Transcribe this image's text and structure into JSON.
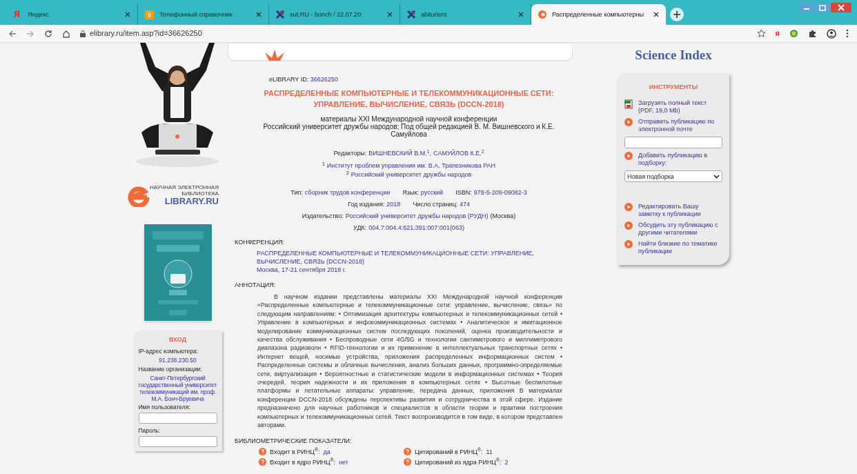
{
  "browser": {
    "tabs": [
      {
        "kind": "letter",
        "glyph": "Я",
        "title": "Яндекс",
        "selected": false
      },
      {
        "kind": "square",
        "glyph": "))",
        "title": "Телефонный справочник",
        "selected": false
      },
      {
        "kind": "cross",
        "title": "sut.RU - bonch / 22.07.20",
        "selected": false
      },
      {
        "kind": "cross",
        "title": "abiturient",
        "selected": false
      },
      {
        "kind": "circle",
        "title": "Распределенные компьютерны",
        "selected": true
      }
    ],
    "url": "elibrary.ru/item.asp?id=36626250",
    "extension_glyph": "я"
  },
  "logo": {
    "line1": "НАУЧНАЯ ЭЛЕКТРОННАЯ",
    "line2": "БИБЛИОТЕКА",
    "name": "LIBRARY.RU"
  },
  "login": {
    "title": "ВХОД",
    "ip_label": "IP-адрес компьютера:",
    "ip": "91.238.230.50",
    "org_label": "Название организации:",
    "org": "Санкт-Петербургский государственный университет телекоммуникаций им. проф. М.А. Бонч-Бруевича",
    "user_label": "Имя пользователя:",
    "password_label": "Пароль:"
  },
  "item": {
    "id_label": "eLIBRARY ID:",
    "id": "36626250",
    "title": "РАСПРЕДЕЛЕННЫЕ КОМПЬЮТЕРНЫЕ И ТЕЛЕКОММУНИКАЦИОННЫЕ СЕТИ: УПРАВЛЕНИЕ, ВЫЧИСЛЕНИЕ, СВЯЗЬ (DCCN-2018)",
    "subtitle": "материалы XXI Международной научной конференции",
    "editorial": "Российский университет дружбы народов; Под общей редакцией В. М. Вишневского и К.Е. Самуйлова",
    "editors_label": "Редакторы:",
    "editors": [
      "ВИШНЕВСКИЙ В.М.$^{1}$,",
      "САМУЙЛОВ К.Е.$^{2}$"
    ],
    "affiliations": [
      {
        "mark": "1",
        "name": "Институт проблем управления им. В.А. Трапезникова РАН"
      },
      {
        "mark": "2",
        "name": "Российский университет дружбы народов"
      }
    ],
    "meta_rows": [
      [
        {
          "label": "Тип:",
          "value": "сборник трудов конференции"
        },
        {
          "label": "Язык:",
          "value": "русский"
        },
        {
          "label": "ISBN:",
          "value": "978-5-209-09082-3"
        }
      ],
      [
        {
          "label": "Год издания:",
          "value": "2018"
        },
        {
          "label": "Число страниц:",
          "value": "474"
        }
      ],
      [
        {
          "label": "Издательство:",
          "value": "Российский университет дружбы народов (РУДН)",
          "suffix": "(Москва)"
        }
      ],
      [
        {
          "label": "УДК:",
          "value": "004.7:004.4:621.391:007:001(063)"
        }
      ]
    ],
    "conference_heading": "КОНФЕРЕНЦИЯ:",
    "conference": "РАСПРЕДЕЛЕННЫЕ КОМПЬЮТЕРНЫЕ И ТЕЛЕКОММУНИКАЦИОННЫЕ СЕТИ: УПРАВЛЕНИЕ, ВЫЧИСЛЕНИЕ, СВЯЗЬ (DCCN-2018)",
    "conference_place": "Москва, 17-21 сентября 2018 г.",
    "abstract_heading": "АННОТАЦИЯ:",
    "abstract": "В научном издании представлены материалы XXI Международной научной конференции «Распределенные компьютерные и телекоммуникационные сети: управление, вычисление, связь» по следующим направлениям: • Оптимизация архитектуры компьютерных и телекоммуникационных сетей • Управление в компьютерных и инфокоммуникационных системах • Аналитическое и имитационное моделирование коммуникационных систем последующих поколений, оценка производительности и качества обслуживания • Беспроводные сети 4G/5G и технологии сантиметрового и миллиметрового диапазона радиоволн • RFID-технологии и их применение в интеллектуальных транспортных сетях • Интернет вещей, носимые устройства, приложения распределенных информационных систем • Распределенные системы и облачные вычисления, анализ больших данных, программно-определяемые сети, виртуализация • Вероятностные и статистические модели в информационных системах • Теория очередей, теория надежности и их приложения в компьютерных сетях • Высотные беспилотные платформы и летательные аппараты: управление, передача данных, приложения В материалах конференции DCCN-2018 обсуждены перспективы развития и сотрудничества в этой сфере. Издание предназначено для научных работников и специалистов в области теории и практики построения компьютерных и телекоммуникационных сетей. Текст воспроизводится в том виде, в котором представлен авторами.",
    "metrics_heading": "БИБЛИОМЕТРИЧЕСКИЕ ПОКАЗАТЕЛИ:",
    "metrics": [
      {
        "label": "Входит в РИНЦ$^{®}$:",
        "value": "да"
      },
      {
        "label": "Цитирований в РИНЦ$^{®}$:",
        "value": "11"
      },
      {
        "label": "Входит в ядро РИНЦ$^{®}$:",
        "value": "нет"
      },
      {
        "label": "Цитирований из ядра РИНЦ$^{®}$:",
        "value": "2"
      }
    ]
  },
  "science_index": "Science Index",
  "tools": {
    "title": "ИНСТРУМЕНТЫ",
    "groups": [
      [
        {
          "kind": "download",
          "text": "Загрузить полный текст (PDF, 19,0 Mb)"
        },
        {
          "kind": "link",
          "text": "Отправить публикацию по электронной почте"
        },
        {
          "kind": "field"
        },
        {
          "kind": "link",
          "text": "Добавить публикацию в подборку:"
        },
        {
          "kind": "select",
          "value": "Новая подборка"
        }
      ],
      [
        {
          "kind": "link",
          "text": "Редактировать Вашу заметку к публикации"
        },
        {
          "kind": "link",
          "text": "Обсудить эту публикацию с другими читателями"
        },
        {
          "kind": "link",
          "text": "Найти близкие по тематике публикации"
        }
      ]
    ]
  }
}
